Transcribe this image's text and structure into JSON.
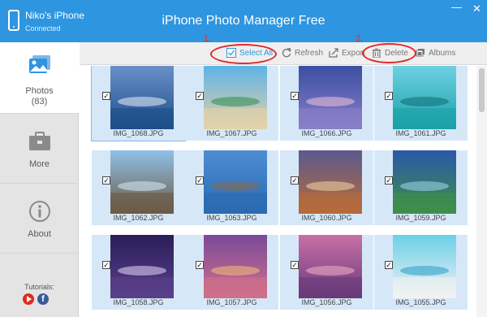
{
  "window": {
    "title": "iPhone Photo Manager Free",
    "min_glyph": "—",
    "close_glyph": "✕"
  },
  "device": {
    "name": "Niko's iPhone",
    "status": "Connected",
    "icon": "phone-icon"
  },
  "sidebar": {
    "items": [
      {
        "label": "Photos",
        "count": "(83)",
        "icon": "photos-icon",
        "active": true
      },
      {
        "label": "More",
        "icon": "toolbox-icon",
        "active": false
      },
      {
        "label": "About",
        "icon": "info-icon",
        "active": false
      }
    ],
    "tutorials_label": "Tutorials:",
    "social": [
      {
        "icon": "youtube-icon"
      },
      {
        "icon": "facebook-icon",
        "glyph": "f"
      }
    ]
  },
  "toolbar": {
    "select_all": "Select All",
    "refresh": "Refresh",
    "export": "Export",
    "delete": "Delete",
    "albums": "Albums"
  },
  "annotations": {
    "step1": "1.",
    "step2": "2."
  },
  "photos": [
    {
      "name": "IMG_1068.JPG",
      "checked": true,
      "sky": "#6a8fc9",
      "ground": "#1d4f8a",
      "accent": "#e9eef6"
    },
    {
      "name": "IMG_1067.JPG",
      "checked": true,
      "sky": "#5fb3e6",
      "ground": "#e4d2a8",
      "accent": "#2f8b4a"
    },
    {
      "name": "IMG_1066.JPG",
      "checked": true,
      "sky": "#3a4fa2",
      "ground": "#8a7ec8",
      "accent": "#f0c2d8"
    },
    {
      "name": "IMG_1061.JPG",
      "checked": true,
      "sky": "#6fd0e2",
      "ground": "#1aa1a8",
      "accent": "#0f6b72"
    },
    {
      "name": "IMG_1062.JPG",
      "checked": true,
      "sky": "#8fc0e8",
      "ground": "#6d5a44",
      "accent": "#d9ecfa"
    },
    {
      "name": "IMG_1063.JPG",
      "checked": true,
      "sky": "#4e8dd2",
      "ground": "#2a6ab0",
      "accent": "#8a6a4a"
    },
    {
      "name": "IMG_1060.JPG",
      "checked": true,
      "sky": "#5b5a8e",
      "ground": "#b86a3a",
      "accent": "#f2d9a0"
    },
    {
      "name": "IMG_1059.JPG",
      "checked": true,
      "sky": "#2a58a8",
      "ground": "#3f8f4a",
      "accent": "#9fd7f0"
    },
    {
      "name": "IMG_1058.JPG",
      "checked": true,
      "sky": "#2a1e5a",
      "ground": "#5a3f8a",
      "accent": "#e8d8f8"
    },
    {
      "name": "IMG_1057.JPG",
      "checked": true,
      "sky": "#7a4a9a",
      "ground": "#d0708a",
      "accent": "#f6c07a"
    },
    {
      "name": "IMG_1056.JPG",
      "checked": true,
      "sky": "#c870a8",
      "ground": "#6a3a7a",
      "accent": "#f2b0c8"
    },
    {
      "name": "IMG_1055.JPG",
      "checked": true,
      "sky": "#6ad0e8",
      "ground": "#f2f2f2",
      "accent": "#2a9ac8"
    }
  ],
  "scrollbar": {
    "position": 0
  }
}
